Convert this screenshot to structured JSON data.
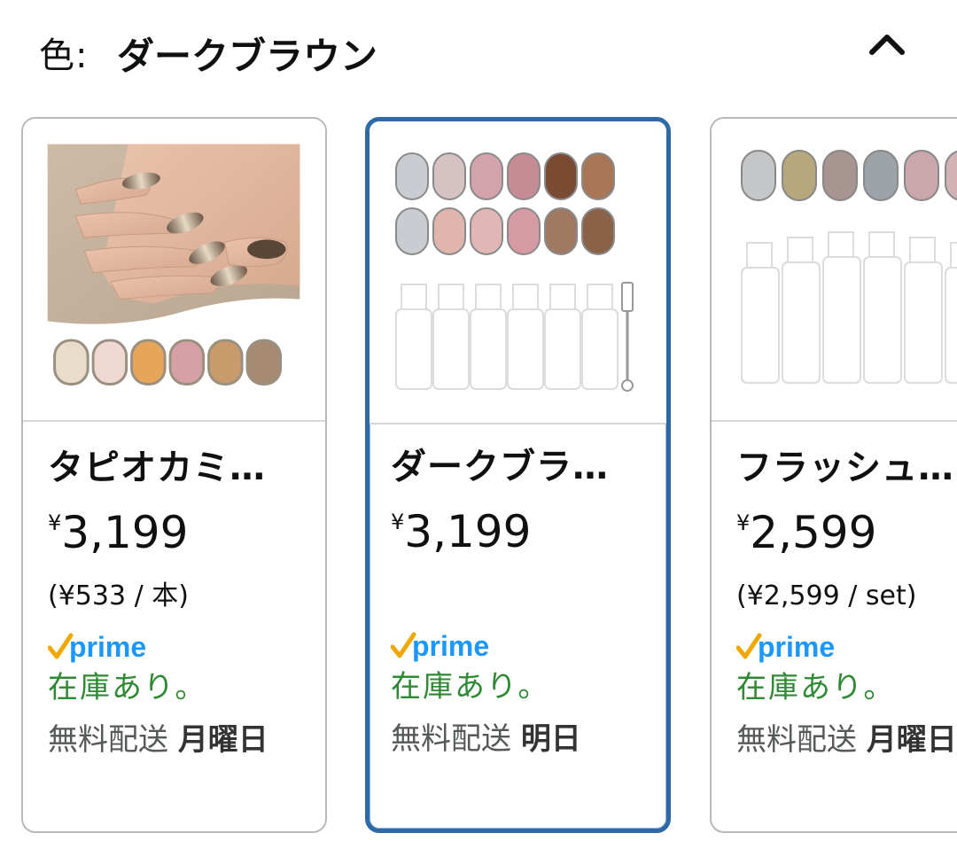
{
  "header": {
    "label": "色:",
    "value": "ダークブラウン",
    "collapse_icon": "chevron-up-icon"
  },
  "products": [
    {
      "name": "タピオカミ…",
      "currency": "¥",
      "price": "3,199",
      "unit_price": "(¥533 / 本)",
      "prime_label": "prime",
      "stock": "在庫あり。",
      "ship_prefix": "無料配送",
      "ship_day": "月曜日",
      "selected": false
    },
    {
      "name": "ダークブラ…",
      "currency": "¥",
      "price": "3,199",
      "unit_price": "",
      "prime_label": "prime",
      "stock": "在庫あり。",
      "ship_prefix": "無料配送",
      "ship_day": "明日",
      "selected": true
    },
    {
      "name": "フラッシュ…",
      "currency": "¥",
      "price": "2,599",
      "unit_price": "(¥2,599 / set)",
      "prime_label": "prime",
      "stock": "在庫あり。",
      "ship_prefix": "無料配送",
      "ship_day": "月曜日",
      "selected": false
    }
  ],
  "colors": {
    "selected_border": "#2e6aa8",
    "prime_blue": "#1a98ff",
    "prime_check": "#f0a800",
    "stock_green": "#2e8a32"
  }
}
